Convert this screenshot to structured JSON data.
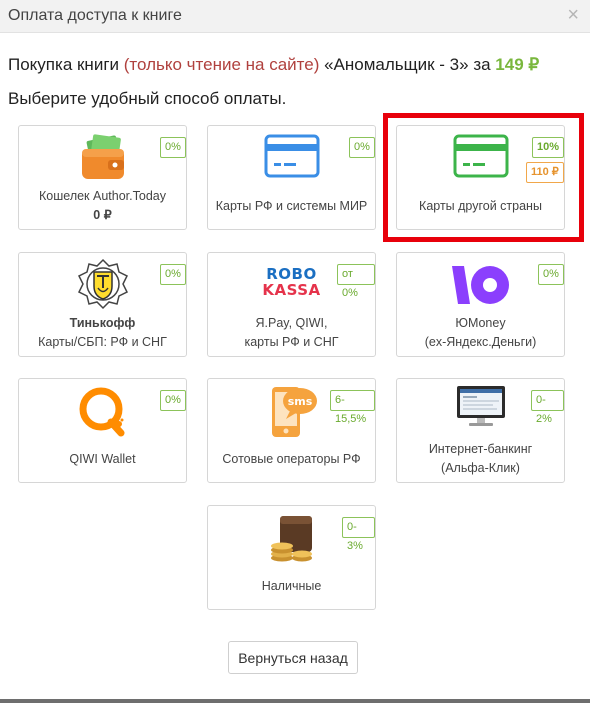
{
  "dialog": {
    "title": "Оплата доступа к книге",
    "close_symbol": "×"
  },
  "purchase": {
    "prefix": "Покупка книги ",
    "mode": "(только чтение на сайте)",
    "book": " «Аномальщик - 3» за ",
    "price": "149 ₽"
  },
  "instruction": "Выберите удобный способ оплаты.",
  "methods": [
    {
      "icon": "wallet-icon",
      "label": "Кошелек Author.Today",
      "balance": "0 ₽",
      "fee": "0%"
    },
    {
      "icon": "bank-card-icon",
      "label": "Карты РФ и системы МИР",
      "fee": "0%"
    },
    {
      "icon": "bank-card-icon",
      "label": "Карты другой страны",
      "fee": "10%",
      "surcharge": "110 ₽",
      "color": "#3cb44a"
    },
    {
      "icon": "tinkoff-logo",
      "name": "Тинькофф",
      "label": "Карты/СБП: РФ и СНГ",
      "fee": "0%"
    },
    {
      "icon": "robokassa-logo",
      "logo_top": "ROBO",
      "logo_bottom": "KASSA",
      "label_line1": "Я.Pay, QIWI,",
      "label_line2": "карты РФ и СНГ",
      "fee": "от 0%"
    },
    {
      "icon": "yoomoney-logo",
      "label_line1": "ЮMoney",
      "label_line2": "(ex-Яндекс.Деньги)",
      "fee": "0%"
    },
    {
      "icon": "qiwi-logo",
      "label": "QIWI Wallet",
      "fee": "0%"
    },
    {
      "icon": "sms-phone-icon",
      "icon_text": "sms",
      "label": "Сотовые операторы РФ",
      "fee": "6-15,5%"
    },
    {
      "icon": "monitor-icon",
      "label_line1": "Интернет-банкинг",
      "label_line2": "(Альфа-Клик)",
      "fee": "0-2%"
    },
    {
      "icon": "cash-wallet-icon",
      "label": "Наличные",
      "fee": "0-3%"
    }
  ],
  "back_button": "Вернуться назад",
  "colors": {
    "accent_green": "#79b73d",
    "highlight_red": "#e8000b",
    "mode_red": "#b0413e",
    "card_blue": "#3a8ee6",
    "yoomoney_purple": "#8b3ffd",
    "qiwi_orange": "#ff8c00"
  }
}
